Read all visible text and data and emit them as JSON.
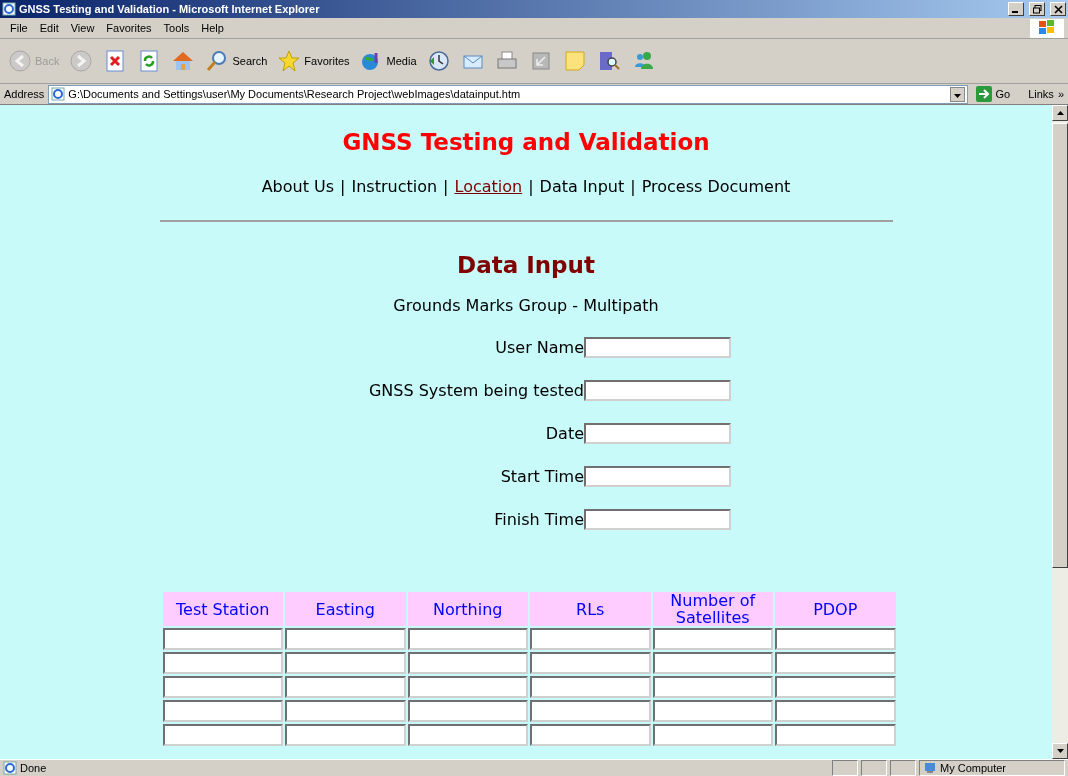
{
  "window": {
    "title": "GNSS Testing and Validation - Microsoft Internet Explorer"
  },
  "menu": [
    "File",
    "Edit",
    "View",
    "Favorites",
    "Tools",
    "Help"
  ],
  "toolbar": [
    {
      "kind": "back",
      "label": "Back",
      "disabled": true
    },
    {
      "kind": "forward",
      "disabled": true
    },
    {
      "kind": "stop",
      "disabled": false
    },
    {
      "kind": "refresh",
      "disabled": false
    },
    {
      "kind": "home",
      "disabled": false
    },
    {
      "kind": "search",
      "label": "Search",
      "disabled": false
    },
    {
      "kind": "favorites",
      "label": "Favorites",
      "disabled": false
    },
    {
      "kind": "media",
      "label": "Media",
      "disabled": false
    },
    {
      "kind": "history",
      "disabled": false
    },
    {
      "kind": "mail",
      "disabled": false
    },
    {
      "kind": "print",
      "disabled": false
    },
    {
      "kind": "edit",
      "disabled": false
    },
    {
      "kind": "notes",
      "disabled": false
    },
    {
      "kind": "research",
      "disabled": false
    },
    {
      "kind": "messenger",
      "disabled": false
    }
  ],
  "address_bar": {
    "label": "Address",
    "value": "G:\\Documents and Settings\\user\\My Documents\\Research Project\\webImages\\datainput.htm",
    "go": "Go",
    "links": "Links",
    "more": "»"
  },
  "page": {
    "title": "GNSS Testing and Validation",
    "nav": [
      {
        "label": "About Us",
        "kind": "text"
      },
      {
        "label": "Instruction",
        "kind": "text"
      },
      {
        "label": "Location",
        "kind": "link"
      },
      {
        "label": "Data Input",
        "kind": "text"
      },
      {
        "label": "Process Document",
        "kind": "text"
      }
    ],
    "nav_separator": "|",
    "heading": "Data Input",
    "subtitle": "Grounds Marks Group - Multipath",
    "fields": [
      {
        "label": "User Name"
      },
      {
        "label": "GNSS System being tested"
      },
      {
        "label": "Date"
      },
      {
        "label": "Start Time"
      },
      {
        "label": "Finish Time"
      }
    ],
    "table": {
      "columns": [
        "Test Station",
        "Easting",
        "Northing",
        "RLs",
        "Number of Satellites",
        "PDOP"
      ],
      "rows": [
        {
          "kind": "inputs"
        },
        {
          "kind": "inputs"
        },
        {
          "kind": "inputs"
        },
        {
          "kind": "inputs"
        },
        {
          "kind": "inputs"
        }
      ]
    }
  },
  "status_bar": {
    "text": "Done",
    "zone": "My Computer"
  }
}
